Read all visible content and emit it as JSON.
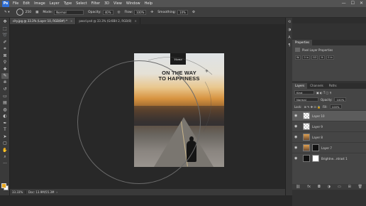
{
  "menubar": {
    "logo": "Ps",
    "items": [
      "File",
      "Edit",
      "Image",
      "Layer",
      "Type",
      "Select",
      "Filter",
      "3D",
      "View",
      "Window",
      "Help"
    ],
    "win_min": "—",
    "win_max": "☐",
    "win_close": "✕"
  },
  "options": {
    "brush_size": "250",
    "mode_label": "Mode:",
    "mode_value": "Normal",
    "opacity_label": "Opacity:",
    "opacity_value": "40%",
    "flow_label": "Flow:",
    "flow_value": "100%",
    "smoothing_label": "Smoothing:",
    "smoothing_value": "10%"
  },
  "tabs": [
    {
      "label": "city.jpg @ 33.3% (Layer 10, RGB/8#) *",
      "close": "×"
    },
    {
      "label": "pwsd.psd @ 33.3% (Gr8Bit 2, RGB/8)",
      "close": "×"
    }
  ],
  "document": {
    "logo_text": "Viana",
    "headline_1": "ON THE WAY",
    "headline_2": "TO HAPPINESS"
  },
  "status": {
    "zoom": "33.33%",
    "doc_info": "Doc: 13.9M/55.3M"
  },
  "properties": {
    "tab": "Properties",
    "kind": "Pixel Layer Properties",
    "w_label": "W:",
    "w_value": "0 in",
    "h_label": "H:",
    "h_value": "0 in",
    "link": "GO"
  },
  "layers_panel": {
    "tabs": [
      "Layers",
      "Channels",
      "Paths"
    ],
    "filter_kind": "Kind",
    "blend_mode": "Normal",
    "opacity_label": "Opacity:",
    "opacity_value": "100%",
    "lock_label": "Lock:",
    "fill_label": "Fill:",
    "fill_value": "100%",
    "layers": [
      {
        "name": "Layer 10"
      },
      {
        "name": "Layer 9"
      },
      {
        "name": "Layer 8"
      },
      {
        "name": "Layer 7"
      },
      {
        "name": "Brightne...ntrast 1"
      }
    ]
  },
  "colors": {
    "accent": "#2f6fd6",
    "foreground": "#e8a820",
    "background": "#ffffff"
  }
}
